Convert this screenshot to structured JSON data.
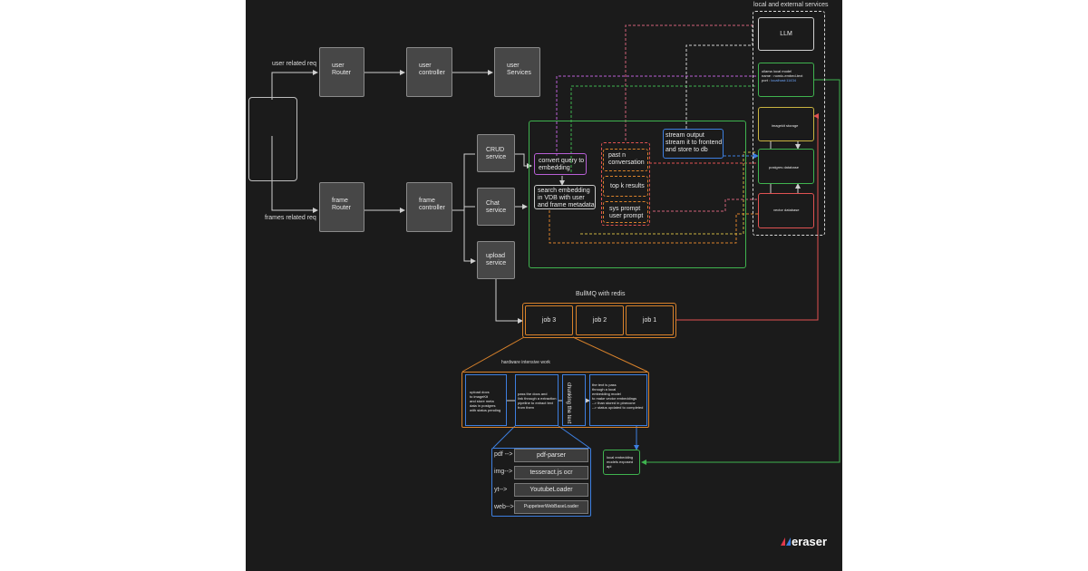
{
  "external_services": {
    "title": "local and external services",
    "llm": "LLM",
    "ollama": [
      "ollama local model",
      "name : nomic-embed-text",
      "port :",
      "localhost:11434"
    ],
    "imagekit": "imagekit storage",
    "postgres": "postgres database",
    "vector": "vector database"
  },
  "routes": {
    "user_req": "user related req",
    "frames_req": "frames related req",
    "user_router": [
      "user",
      "Router"
    ],
    "user_controller": [
      "user",
      "controller"
    ],
    "user_services": [
      "user",
      "Services"
    ],
    "frame_router": [
      "frame",
      "Router"
    ],
    "frame_controller": [
      "frame",
      "controller"
    ],
    "crud_service": [
      "CRUD",
      "service"
    ],
    "chat_service": [
      "Chat",
      "service"
    ],
    "upload_service": [
      "upload",
      "service"
    ]
  },
  "chat_pipeline": {
    "convert_query": [
      "convert query to",
      "embedding"
    ],
    "search_embedding": [
      "search embedding",
      "in VDB with user",
      "and frame metadata"
    ],
    "past_n": [
      "past n",
      "conversation"
    ],
    "top_k": "top k results",
    "sys_prompt": [
      "sys prompt",
      "user prompt"
    ],
    "stream_output": [
      "stream output",
      "stream it to frontend",
      " and store to db"
    ]
  },
  "queue": {
    "title": "BullMQ with redis",
    "jobs": [
      "job 3",
      "job 2",
      "job 1"
    ]
  },
  "hardware": {
    "title": "hardware intensive work",
    "step1": [
      "upload docs",
      "to imageKit",
      "and store meta",
      "data in postgres",
      "with status pending"
    ],
    "step2": [
      "pass the docs and",
      "link through a extraction",
      "pipeline to extract text",
      "from them"
    ],
    "step3": "chunking the text",
    "step4": [
      "the text is pass",
      "through a local",
      "embedding model",
      "to make vector embeddings",
      "--> than stored in pinecone",
      "--> status updated to completed"
    ]
  },
  "extractors": [
    {
      "key": "pdf -->",
      "tool": "pdf-parser"
    },
    {
      "key": "img-->",
      "tool": "tesseract.js ocr"
    },
    {
      "key": "yt-->",
      "tool": "YoutubeLoader"
    },
    {
      "key": "web-->",
      "tool": "PuppeteerWebBaseLoader"
    }
  ],
  "local_embedding": [
    "local embedding",
    "models exposed",
    "api"
  ],
  "brand": "eraser",
  "colors": {
    "bg": "#1b1b1b",
    "green": "#3fb34f",
    "orange": "#d9822b",
    "red": "#e05252",
    "purple": "#b85fd6",
    "blue": "#3d7fe0",
    "yellow": "#c9b340",
    "pink": "#d0607a"
  }
}
